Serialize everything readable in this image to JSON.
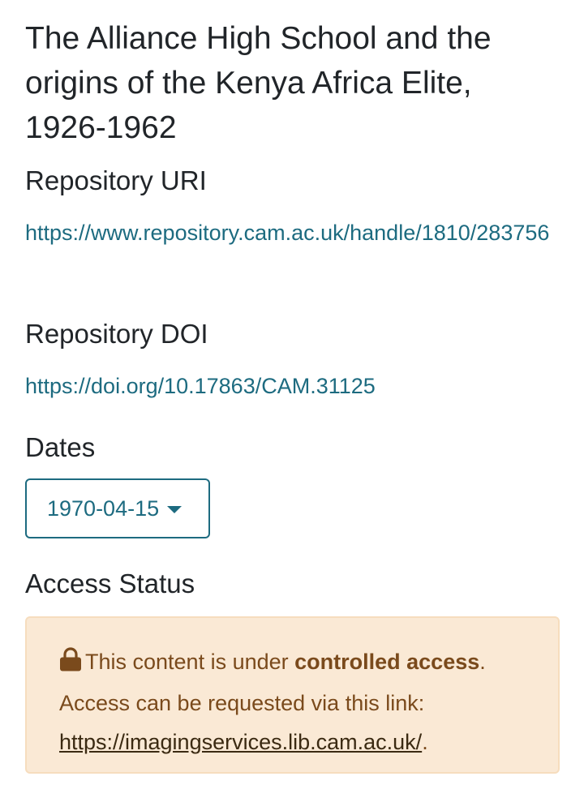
{
  "item": {
    "title": "The Alliance High School and the origins of the Kenya Africa Elite, 1926-1962"
  },
  "repository_uri": {
    "heading": "Repository URI",
    "url": "https://www.repository.cam.ac.uk/handle/1810/283756"
  },
  "repository_doi": {
    "heading": "Repository DOI",
    "url": "https://doi.org/10.17863/CAM.31125"
  },
  "dates": {
    "heading": "Dates",
    "selected": "1970-04-15"
  },
  "access_status": {
    "heading": "Access Status",
    "icon": "lock-icon",
    "text_before": "This content is under ",
    "emphasis": "controlled access",
    "text_after": ".",
    "line2": "Access can be requested via this link:",
    "link": "https://imagingservices.lib.cam.ac.uk/",
    "link_suffix": "."
  },
  "colors": {
    "link": "#1d6b80",
    "alert_background": "#fae9d5",
    "alert_text": "#7a4a1c"
  }
}
